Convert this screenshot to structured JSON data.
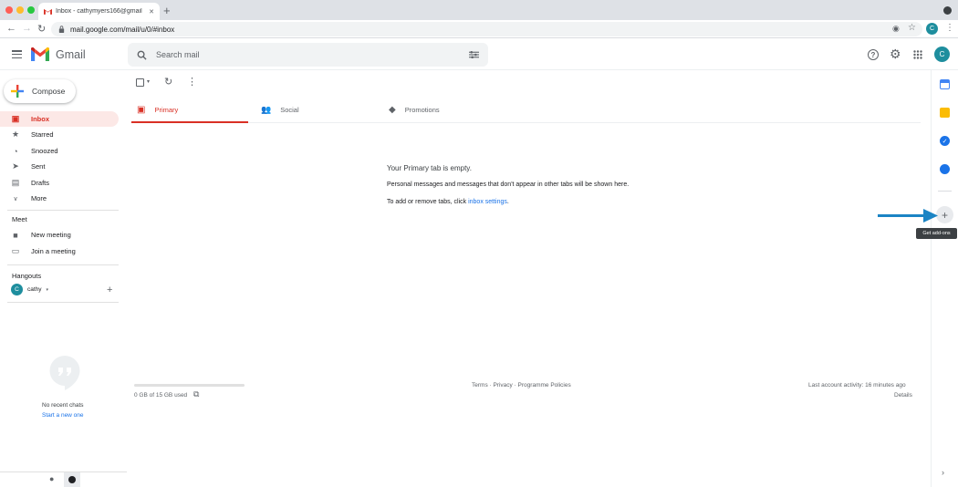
{
  "browser": {
    "tab_title": "Inbox - cathymyers166@gmail",
    "tab_close": "✕",
    "new_tab": "+",
    "url": "mail.google.com/mail/u/0/#inbox",
    "profile_initial": "C"
  },
  "header": {
    "logo_text": "Gmail",
    "search_placeholder": "Search mail",
    "avatar_initial": "C"
  },
  "compose_label": "Compose",
  "sidebar": {
    "items": [
      {
        "label": "Inbox",
        "icon": "inbox-icon"
      },
      {
        "label": "Starred",
        "icon": "star-icon"
      },
      {
        "label": "Snoozed",
        "icon": "clock-icon"
      },
      {
        "label": "Sent",
        "icon": "send-icon"
      },
      {
        "label": "Drafts",
        "icon": "draft-icon"
      },
      {
        "label": "More",
        "icon": "chevron-down-icon"
      }
    ],
    "meet_label": "Meet",
    "meet_items": [
      {
        "label": "New meeting",
        "icon": "video-icon"
      },
      {
        "label": "Join a meeting",
        "icon": "keyboard-icon"
      }
    ],
    "hangouts_label": "Hangouts",
    "hangouts_user": "cathy",
    "hangouts_initial": "C",
    "no_chats": "No recent chats",
    "start_new": "Start a new one"
  },
  "main": {
    "tabs": [
      {
        "label": "Primary",
        "icon": "inbox-icon"
      },
      {
        "label": "Social",
        "icon": "people-icon"
      },
      {
        "label": "Promotions",
        "icon": "tag-icon"
      }
    ],
    "empty_title": "Your Primary tab is empty.",
    "empty_desc": "Personal messages and messages that don't appear in other tabs will be shown here.",
    "settings_prefix": "To add or remove tabs, click ",
    "settings_link": "inbox settings",
    "settings_suffix": "."
  },
  "footer": {
    "storage": "0 GB of 15 GB used",
    "storage_fraction": 0.0,
    "links": "Terms · Privacy · Programme Policies",
    "activity": "Last account activity: 16 minutes ago",
    "details": "Details"
  },
  "rail": {
    "tooltip": "Get add-ons",
    "add_symbol": "+"
  },
  "colors": {
    "accent_red": "#d93025",
    "link_blue": "#1a73e8",
    "arrow_blue": "#1b84c4",
    "avatar_teal": "#1e8e9e"
  }
}
